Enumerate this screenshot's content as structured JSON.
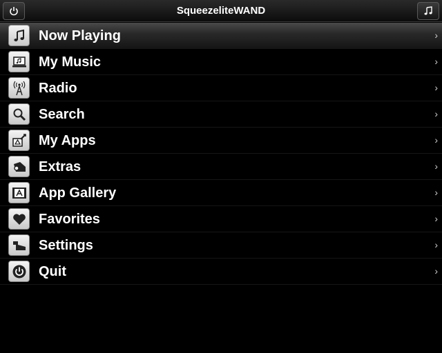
{
  "header": {
    "title": "SqueezeliteWAND",
    "left_button_icon": "power-icon",
    "right_button_icon": "music-note-icon"
  },
  "menu": {
    "chevron": "›",
    "selected_index": 0,
    "items": [
      {
        "label": "Now Playing",
        "icon": "music-note-icon"
      },
      {
        "label": "My Music",
        "icon": "laptop-music-icon"
      },
      {
        "label": "Radio",
        "icon": "radio-tower-icon"
      },
      {
        "label": "Search",
        "icon": "magnifier-icon"
      },
      {
        "label": "My Apps",
        "icon": "apps-icon"
      },
      {
        "label": "Extras",
        "icon": "extras-icon"
      },
      {
        "label": "App Gallery",
        "icon": "app-gallery-icon"
      },
      {
        "label": "Favorites",
        "icon": "heart-icon"
      },
      {
        "label": "Settings",
        "icon": "settings-icon"
      },
      {
        "label": "Quit",
        "icon": "power-icon"
      }
    ]
  }
}
